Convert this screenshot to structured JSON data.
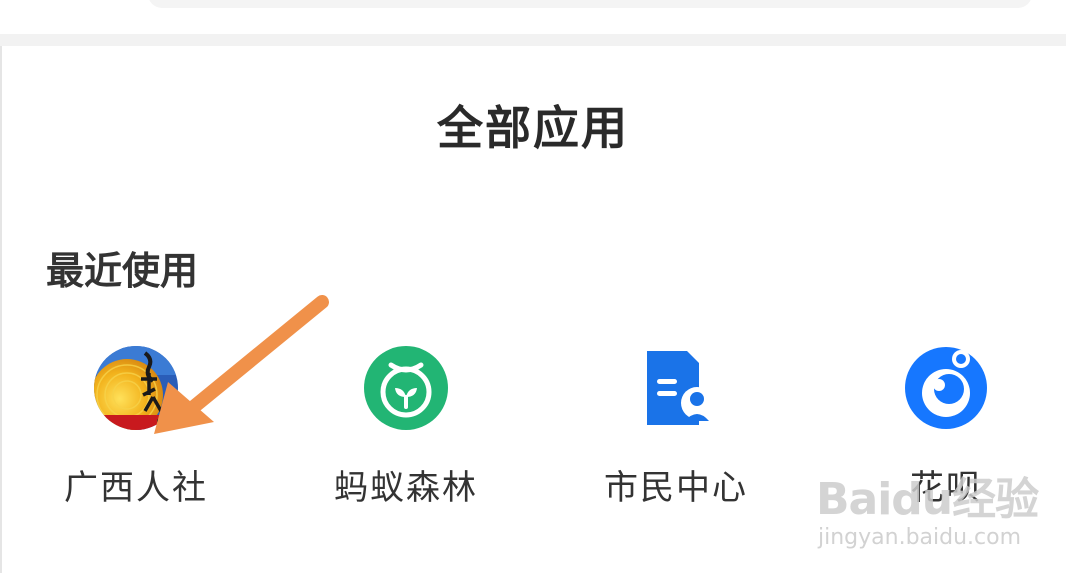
{
  "header": {
    "title": "全部应用"
  },
  "recent": {
    "section_title": "最近使用",
    "apps": [
      {
        "label": "广西人社",
        "icon": "guangxi-renshe-logo"
      },
      {
        "label": "蚂蚁森林",
        "icon": "sprout-icon"
      },
      {
        "label": "市民中心",
        "icon": "citizen-document-icon"
      },
      {
        "label": "花呗",
        "icon": "huabei-icon"
      }
    ]
  },
  "watermark": {
    "logo": "Baidu经验",
    "url": "jingyan.baidu.com"
  },
  "colors": {
    "title_text": "#2a2a2a",
    "label_text": "#333333",
    "ant_forest_green": "#22b574",
    "citizen_blue": "#1a73e8",
    "huabei_blue": "#1677ff",
    "annotation_arrow": "#f0914a"
  }
}
